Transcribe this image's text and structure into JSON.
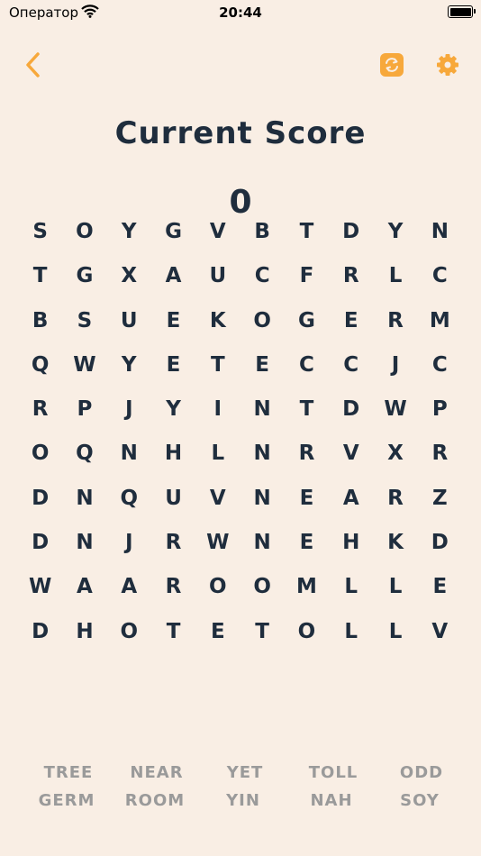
{
  "status_bar": {
    "carrier": "Оператор",
    "time": "20:44"
  },
  "header": {
    "back_icon": "chevron-left-icon",
    "refresh_icon": "refresh-icon",
    "settings_icon": "gear-icon",
    "accent_color": "#f7a83b"
  },
  "title": "Current Score",
  "score": "0",
  "grid": [
    [
      "S",
      "O",
      "Y",
      "G",
      "V",
      "B",
      "T",
      "D",
      "Y",
      "N"
    ],
    [
      "T",
      "G",
      "X",
      "A",
      "U",
      "C",
      "F",
      "R",
      "L",
      "C"
    ],
    [
      "B",
      "S",
      "U",
      "E",
      "K",
      "O",
      "G",
      "E",
      "R",
      "M"
    ],
    [
      "Q",
      "W",
      "Y",
      "E",
      "T",
      "E",
      "C",
      "C",
      "J",
      "C"
    ],
    [
      "R",
      "P",
      "J",
      "Y",
      "I",
      "N",
      "T",
      "D",
      "W",
      "P"
    ],
    [
      "O",
      "Q",
      "N",
      "H",
      "L",
      "N",
      "R",
      "V",
      "X",
      "R"
    ],
    [
      "D",
      "N",
      "Q",
      "U",
      "V",
      "N",
      "E",
      "A",
      "R",
      "Z"
    ],
    [
      "D",
      "N",
      "J",
      "R",
      "W",
      "N",
      "E",
      "H",
      "K",
      "D"
    ],
    [
      "W",
      "A",
      "A",
      "R",
      "O",
      "O",
      "M",
      "L",
      "L",
      "E"
    ],
    [
      "D",
      "H",
      "O",
      "T",
      "E",
      "T",
      "O",
      "L",
      "L",
      "V"
    ]
  ],
  "words": [
    [
      "TREE",
      "NEAR",
      "YET",
      "TOLL",
      "ODD"
    ],
    [
      "GERM",
      "ROOM",
      "YIN",
      "NAH",
      "SOY"
    ]
  ]
}
